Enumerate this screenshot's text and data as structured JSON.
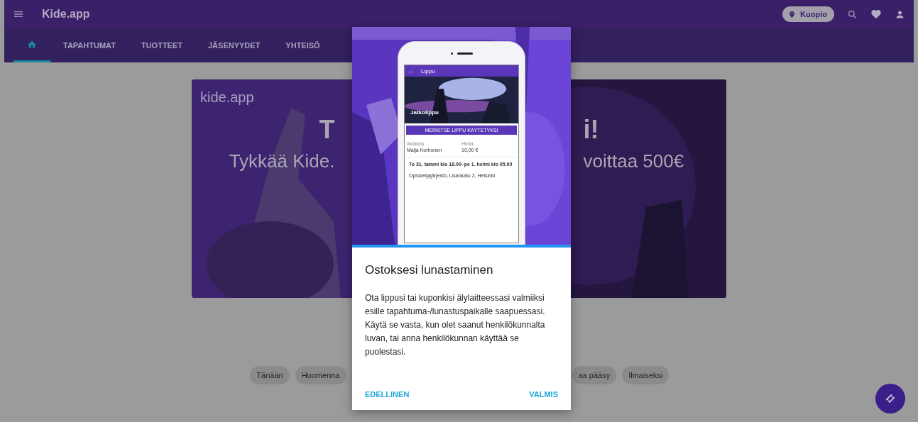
{
  "header": {
    "title": "Kide.app",
    "location": "Kuopio"
  },
  "tabs": [
    {
      "kind": "home",
      "selected": true
    },
    {
      "kind": "text",
      "label": "TAPAHTUMAT",
      "selected": false
    },
    {
      "kind": "text",
      "label": "TUOTTEET",
      "selected": false
    },
    {
      "kind": "text",
      "label": "JÄSENYYDET",
      "selected": false
    },
    {
      "kind": "text",
      "label": "YHTEISÖ",
      "selected": false
    }
  ],
  "banner": {
    "logo": "kide.app",
    "headline_left": "T",
    "headline_right": "i!",
    "subline_left": "Tykkää Kide.",
    "subline_right": "voittaa 500€"
  },
  "chips_left": [
    "Tänään",
    "Huomenna"
  ],
  "chips_right": [
    "aa pääsy",
    "Ilmaiseksi"
  ],
  "dialog": {
    "phone": {
      "back_icon": "←",
      "screen_title": "Lippu",
      "ticket_name": "Jatkolippu",
      "action": "MERKITSE LIPPU KÄYTETYKSI",
      "customer_label": "Asiakas",
      "customer": "Maija Korhonen",
      "price_label": "Hinta",
      "price": "10,00 €",
      "time": "To 31. tammi klo 18.00–pe 1. helmi klo 05.00",
      "place": "Opiskelijajärjestö, Lisankatu 2, Helsinki"
    },
    "title": "Ostoksesi lunastaminen",
    "text": "Ota lippusi tai kuponkisi älylaitteessasi valmiiksi esille tapahtuma-/lunastuspaikalle saapuessasi. Käytä se vasta, kun olet saanut henkilökunnalta luvan, tai anna henkilökunnan käyttää se puolestasi.",
    "buttons": [
      "EDELLINEN",
      "VALMIS"
    ]
  }
}
